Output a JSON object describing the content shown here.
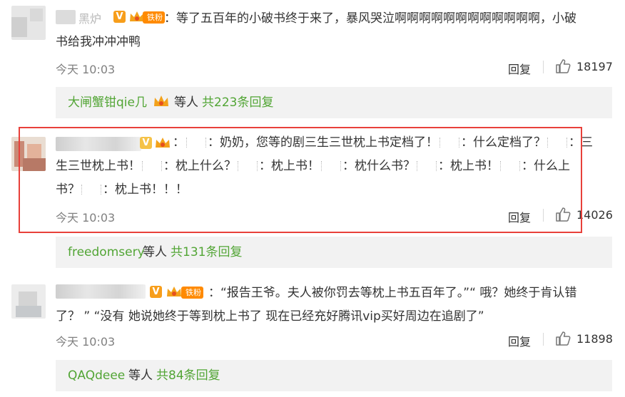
{
  "comments": [
    {
      "username_partial": "黑炉",
      "text_line1": "：等了五百年的小破书终于来了，暴风哭泣啊啊啊啊啊啊啊啊啊啊啊啊，小破",
      "text_line2": "书给我冲冲冲鸭",
      "fan_badge": "铁粉",
      "time": "今天 10:03",
      "reply_label": "回复",
      "like_count": "18197",
      "sub_replies": {
        "who": "大闸蟹钳qie几",
        "etc": "等人",
        "count": "共223条回复"
      }
    },
    {
      "text_line1_a": "：",
      "text_line1_b": "：奶奶，您等的剧三生三世枕上书定档了！",
      "text_line1_c": "：什么定档了？",
      "text_line1_d": "：三",
      "text_line2_a": "生三世枕上书！",
      "text_line2_b": "：枕上什么？",
      "text_line2_c": "：枕上书！",
      "text_line2_d": "：枕什么书？",
      "text_line2_e": "：枕上书！",
      "text_line2_f": "：什么上",
      "text_line3_a": "书？",
      "text_line3_b": "：枕上书！！！",
      "time": "今天 10:03",
      "reply_label": "回复",
      "like_count": "14026",
      "sub_replies": {
        "who": "freedomsery",
        "etc": "等人",
        "count": "共131条回复"
      }
    },
    {
      "text_line1": "：“报告王爷。夫人被你罚去等枕上书五百年了。”“ 哦？她终于肯认错",
      "text_line2": "了？ ”   “没有 她说她终于等到枕上书了 现在已经充好腾讯vip买好周边在追剧了”",
      "fan_badge": "铁粉",
      "time": "今天 10:03",
      "reply_label": "回复",
      "like_count": "11898",
      "sub_replies": {
        "who": "QAQdeee",
        "etc": "等人",
        "count": "共84条回复"
      }
    }
  ],
  "icons": {
    "like": "thumbs-up-icon",
    "verified": "v-icon",
    "crown": "crown-icon"
  },
  "colors": {
    "link_green": "#52a535",
    "highlight_red": "#e8403a",
    "badge_orange": "#ff8a00"
  }
}
